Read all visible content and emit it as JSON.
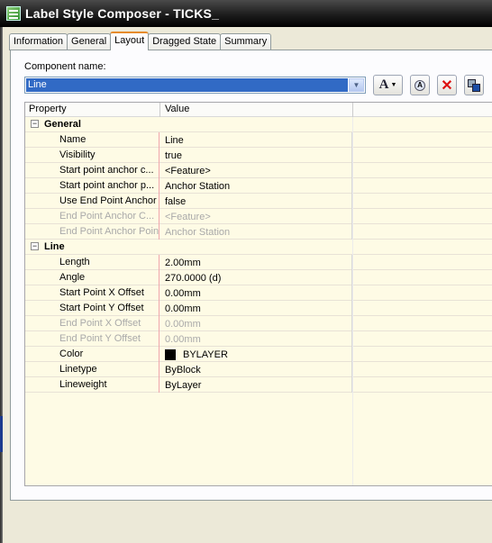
{
  "window": {
    "title": "Label Style Composer - TICKS_"
  },
  "tabs": [
    {
      "label": "Information",
      "active": false
    },
    {
      "label": "General",
      "active": false
    },
    {
      "label": "Layout",
      "active": true
    },
    {
      "label": "Dragged State",
      "active": false
    },
    {
      "label": "Summary",
      "active": false
    }
  ],
  "component": {
    "label": "Component name:",
    "value": "Line",
    "text_button_glyph": "A"
  },
  "grid": {
    "header": {
      "property": "Property",
      "value": "Value"
    },
    "categories": [
      {
        "name": "General",
        "rows": [
          {
            "property": "Name",
            "value": "Line",
            "disabled": false
          },
          {
            "property": "Visibility",
            "value": "true",
            "disabled": false
          },
          {
            "property": "Start point anchor c...",
            "value": "<Feature>",
            "disabled": false
          },
          {
            "property": "Start point anchor p...",
            "value": "Anchor Station",
            "disabled": false
          },
          {
            "property": "Use End Point Anchor",
            "value": "false",
            "disabled": false
          },
          {
            "property": "End Point Anchor C...",
            "value": "<Feature>",
            "disabled": true
          },
          {
            "property": "End Point Anchor Point",
            "value": "Anchor Station",
            "disabled": true
          }
        ]
      },
      {
        "name": "Line",
        "rows": [
          {
            "property": "Length",
            "value": "2.00mm",
            "disabled": false
          },
          {
            "property": "Angle",
            "value": "270.0000 (d)",
            "disabled": false
          },
          {
            "property": "Start Point X Offset",
            "value": "0.00mm",
            "disabled": false
          },
          {
            "property": "Start Point Y Offset",
            "value": "0.00mm",
            "disabled": false
          },
          {
            "property": "End Point X Offset",
            "value": "0.00mm",
            "disabled": true
          },
          {
            "property": "End Point Y Offset",
            "value": "0.00mm",
            "disabled": true
          },
          {
            "property": "Color",
            "value": "BYLAYER",
            "disabled": false,
            "swatch": "#000000"
          },
          {
            "property": "Linetype",
            "value": "ByBlock",
            "disabled": false
          },
          {
            "property": "Lineweight",
            "value": "ByLayer",
            "disabled": false
          }
        ]
      }
    ]
  },
  "colors": {
    "grid_background": "#fefbe5",
    "selection": "#316ac5",
    "active_tab_accent": "#e68b2c"
  },
  "icons": [
    "app-icon",
    "text-component-icon",
    "copy-component-icon",
    "delete-icon",
    "draw-order-icon",
    "collapse-icon"
  ]
}
